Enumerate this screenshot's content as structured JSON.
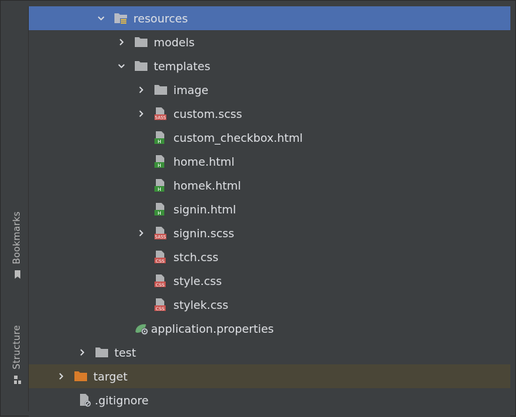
{
  "sidebar": {
    "bookmarks_label": "Bookmarks",
    "structure_label": "Structure"
  },
  "colors": {
    "background": "#3c3f41",
    "selected": "#4b6eaf",
    "target_row": "#4a4637",
    "folder": "#afb1b3",
    "target_folder": "#d87c2a",
    "sass_badge": "#c75450",
    "html_badge": "#3a8f3a",
    "css_badge": "#c75450"
  },
  "tree": {
    "items": [
      {
        "label": "resources",
        "icon": "resources-folder-icon",
        "expanded": true,
        "selected": true
      },
      {
        "label": "models",
        "icon": "folder-icon",
        "expanded": false
      },
      {
        "label": "templates",
        "icon": "folder-icon",
        "expanded": true
      },
      {
        "label": "image",
        "icon": "folder-icon",
        "expanded": false
      },
      {
        "label": "custom.scss",
        "icon": "sass-file-icon",
        "expanded": false,
        "badge": "SASS"
      },
      {
        "label": "custom_checkbox.html",
        "icon": "html-file-icon",
        "badge": "H"
      },
      {
        "label": "home.html",
        "icon": "html-file-icon",
        "badge": "H"
      },
      {
        "label": "homek.html",
        "icon": "html-file-icon",
        "badge": "H"
      },
      {
        "label": "signin.html",
        "icon": "html-file-icon",
        "badge": "H"
      },
      {
        "label": "signin.scss",
        "icon": "sass-file-icon",
        "expanded": false,
        "badge": "SASS"
      },
      {
        "label": "stch.css",
        "icon": "css-file-icon",
        "badge": "CSS"
      },
      {
        "label": "style.css",
        "icon": "css-file-icon",
        "badge": "CSS"
      },
      {
        "label": "stylek.css",
        "icon": "css-file-icon",
        "badge": "CSS"
      },
      {
        "label": "application.properties",
        "icon": "spring-properties-icon"
      },
      {
        "label": "test",
        "icon": "folder-icon",
        "expanded": false
      },
      {
        "label": "target",
        "icon": "target-folder-icon",
        "expanded": false
      },
      {
        "label": ".gitignore",
        "icon": "gitignore-file-icon"
      }
    ]
  }
}
